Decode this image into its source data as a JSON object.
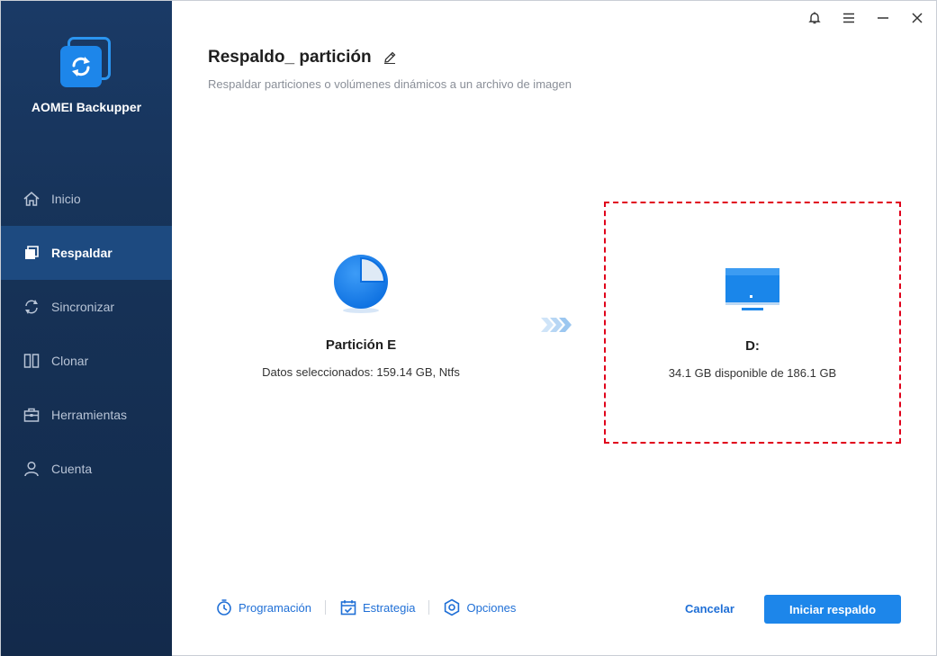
{
  "app": {
    "brand": "AOMEI Backupper"
  },
  "sidebar": {
    "items": [
      {
        "label": "Inicio",
        "icon": "home-icon",
        "active": false
      },
      {
        "label": "Respaldar",
        "icon": "backup-icon",
        "active": true
      },
      {
        "label": "Sincronizar",
        "icon": "sync-icon",
        "active": false
      },
      {
        "label": "Clonar",
        "icon": "clone-icon",
        "active": false
      },
      {
        "label": "Herramientas",
        "icon": "toolbox-icon",
        "active": false
      },
      {
        "label": "Cuenta",
        "icon": "user-icon",
        "active": false
      }
    ]
  },
  "header": {
    "title": "Respaldo_ partición",
    "subtitle": "Respaldar particiones o volúmenes dinámicos a un archivo de imagen"
  },
  "source": {
    "name": "Partición E",
    "detail": "Datos seleccionados: 159.14 GB, Ntfs",
    "icon": "partition-pie-icon"
  },
  "destination": {
    "name": "D:",
    "detail": "34.1 GB disponible de 186.1 GB",
    "icon": "monitor-icon"
  },
  "footer": {
    "schedule_label": "Programación",
    "strategy_label": "Estrategia",
    "options_label": "Opciones",
    "cancel_label": "Cancelar",
    "start_label": "Iniciar respaldo"
  },
  "colors": {
    "accent": "#1d86ea",
    "link": "#1f6fd6",
    "sidebar": "#163257",
    "highlight": "#e0001b"
  }
}
